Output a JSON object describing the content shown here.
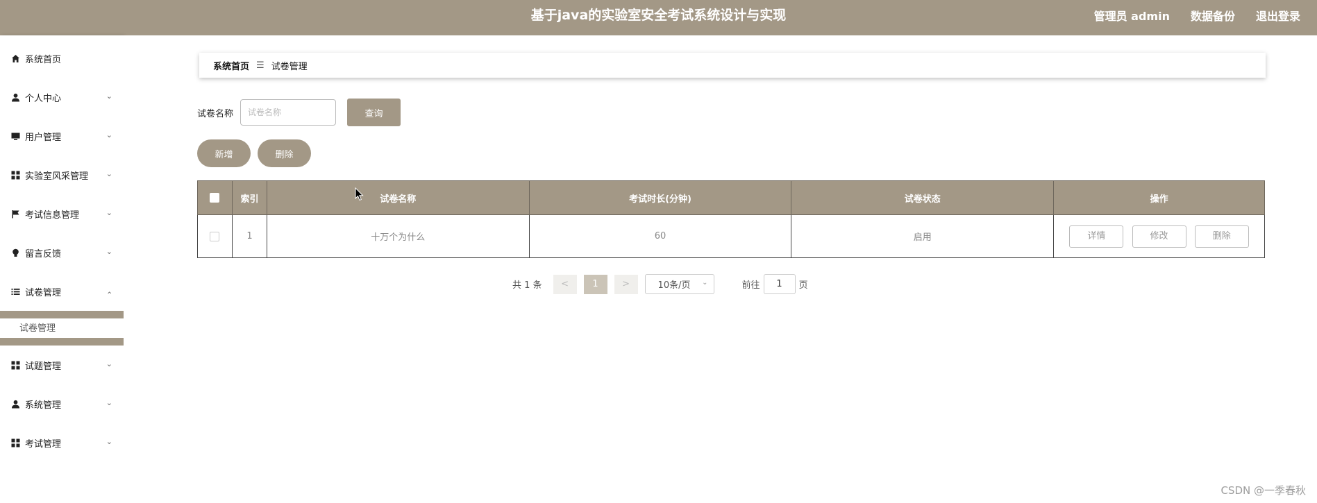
{
  "header": {
    "title": "基于java的实验室安全考试系统设计与实现",
    "admin_label": "管理员 admin",
    "backup_label": "数据备份",
    "logout_label": "退出登录"
  },
  "sidebar": {
    "items": [
      {
        "label": "系统首页",
        "icon": "home-icon"
      },
      {
        "label": "个人中心",
        "icon": "user-icon"
      },
      {
        "label": "用户管理",
        "icon": "monitor-icon"
      },
      {
        "label": "实验室风采管理",
        "icon": "grid-icon"
      },
      {
        "label": "考试信息管理",
        "icon": "flag-icon"
      },
      {
        "label": "留言反馈",
        "icon": "bulb-icon"
      },
      {
        "label": "试卷管理",
        "icon": "list-icon"
      },
      {
        "label": "试题管理",
        "icon": "grid-icon"
      },
      {
        "label": "系统管理",
        "icon": "user-icon"
      },
      {
        "label": "考试管理",
        "icon": "grid-icon"
      }
    ],
    "submenu_label": "试卷管理"
  },
  "breadcrumb": {
    "home": "系统首页",
    "separator": "☰",
    "current": "试卷管理"
  },
  "search": {
    "label": "试卷名称",
    "placeholder": "试卷名称",
    "button_label": "查询"
  },
  "actions": {
    "add_label": "新增",
    "delete_label": "删除"
  },
  "table": {
    "headers": [
      "索引",
      "试卷名称",
      "考试时长(分钟)",
      "试卷状态",
      "操作"
    ],
    "rows": [
      {
        "index": "1",
        "name": "十万个为什么",
        "duration": "60",
        "status": "启用",
        "ops": [
          "详情",
          "修改",
          "删除"
        ]
      }
    ]
  },
  "pager": {
    "total": "共 1 条",
    "prev": "<",
    "page": "1",
    "next": ">",
    "page_size": "10条/页",
    "goto_label": "前往",
    "goto_value": "1",
    "page_suffix": "页"
  },
  "watermark": "CSDN @一季春秋",
  "colors": {
    "accent": "#a39886"
  }
}
